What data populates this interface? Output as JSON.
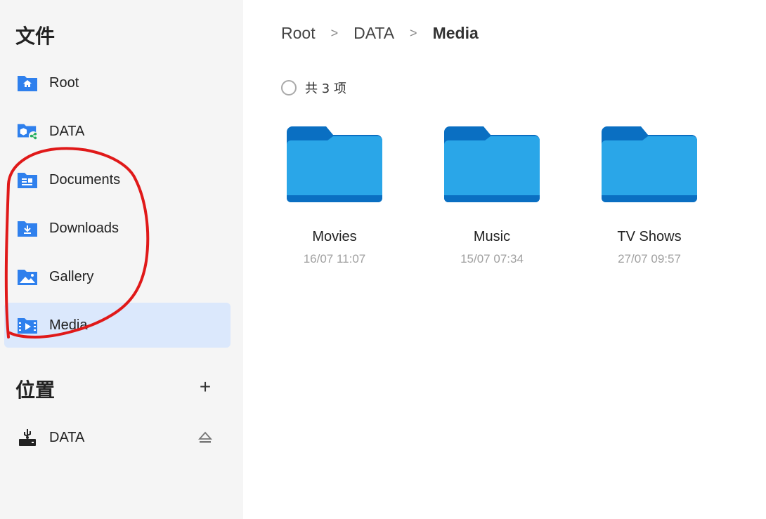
{
  "sidebar": {
    "files_title": "文件",
    "items": [
      {
        "label": "Root",
        "icon": "home-folder-icon"
      },
      {
        "label": "DATA",
        "icon": "shared-folder-icon"
      },
      {
        "label": "Documents",
        "icon": "documents-folder-icon"
      },
      {
        "label": "Downloads",
        "icon": "downloads-folder-icon"
      },
      {
        "label": "Gallery",
        "icon": "gallery-icon"
      },
      {
        "label": "Media",
        "icon": "media-folder-icon"
      }
    ],
    "locations_title": "位置",
    "add_symbol": "+",
    "locations": [
      {
        "label": "DATA",
        "icon": "usb-drive-icon"
      }
    ]
  },
  "breadcrumb": {
    "items": [
      "Root",
      "DATA",
      "Media"
    ],
    "separator": ">"
  },
  "selection": {
    "count_text": "共 3 项"
  },
  "folders": [
    {
      "name": "Movies",
      "date": "16/07 11:07"
    },
    {
      "name": "Music",
      "date": "15/07 07:34"
    },
    {
      "name": "TV Shows",
      "date": "27/07 09:57"
    }
  ],
  "colors": {
    "accent": "#2f80ed",
    "active_bg": "#dbe8fc",
    "folder_light": "#2aa6e8",
    "folder_dark": "#0a6fc2",
    "annotation": "#e01919"
  }
}
